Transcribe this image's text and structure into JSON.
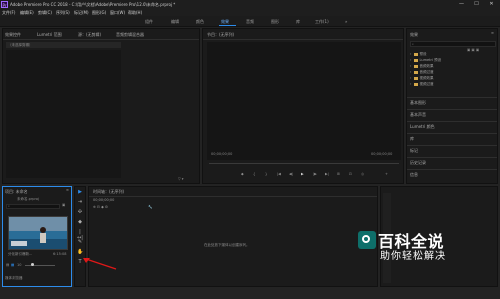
{
  "titlebar": {
    "app_icon": "Pr",
    "title": "Adobe Premiere Pro CC 2018 - C:\\用户\\文档\\Adobe\\Premiere Pro\\12.0\\未命名.prproj *",
    "minimize": "—",
    "maximize": "☐",
    "close": "✕"
  },
  "menu": [
    "文件(F)",
    "编辑(E)",
    "剪辑(C)",
    "序列(S)",
    "标记(M)",
    "图形(G)",
    "窗口(W)",
    "帮助(H)"
  ],
  "workspaces": [
    "组件",
    "编辑",
    "颜色",
    "效果",
    "音频",
    "图形",
    "库",
    "工作(1)"
  ],
  "workspace_active": "效果",
  "source_panel": {
    "tabs": [
      "效果控件",
      "Lumetri 范围",
      "源：(无剪辑)",
      "音频剪辑混合器"
    ],
    "empty_row": "（未选择剪辑）",
    "toolbar": "▽ ▾"
  },
  "program_panel": {
    "title": "节目：(无序列)",
    "timecode_left": "00;00;00;00",
    "timecode_right": "00;00;00;00",
    "controls": [
      "◆",
      "{",
      "}",
      "|◀",
      "◀|",
      "▶",
      "|▶",
      "▶|",
      "⊞",
      "⊡",
      "◎",
      "+"
    ]
  },
  "effects_panel": {
    "title": "效果",
    "search_placeholder": "",
    "folders": [
      "预设",
      "Lumetri 预设",
      "音频效果",
      "音频过渡",
      "视频效果",
      "视频过渡"
    ],
    "sections": [
      "基本图形",
      "基本声音",
      "Lumetri 颜色",
      "库",
      "标记",
      "历史记录",
      "信息"
    ]
  },
  "project_panel": {
    "title": "项目: 未命名",
    "file": "未命名.prproj",
    "clip_name": "分化新引爆新...",
    "clip_duration": "6:15:08",
    "zoom": "10",
    "bottom_label": "媒体浏览器"
  },
  "timeline_panel": {
    "title": "时间轴：(无序列)",
    "timecode": "00;00;00;00",
    "empty_msg": "在此处放下媒体以创建序列。"
  },
  "tools": [
    "▶",
    "⇥",
    "✣",
    "◆",
    "|↔|",
    "✎",
    "✋",
    "T"
  ],
  "arrow_color": "#e01818",
  "watermark": {
    "title": "百科全说",
    "subtitle": "助你轻松解决"
  }
}
